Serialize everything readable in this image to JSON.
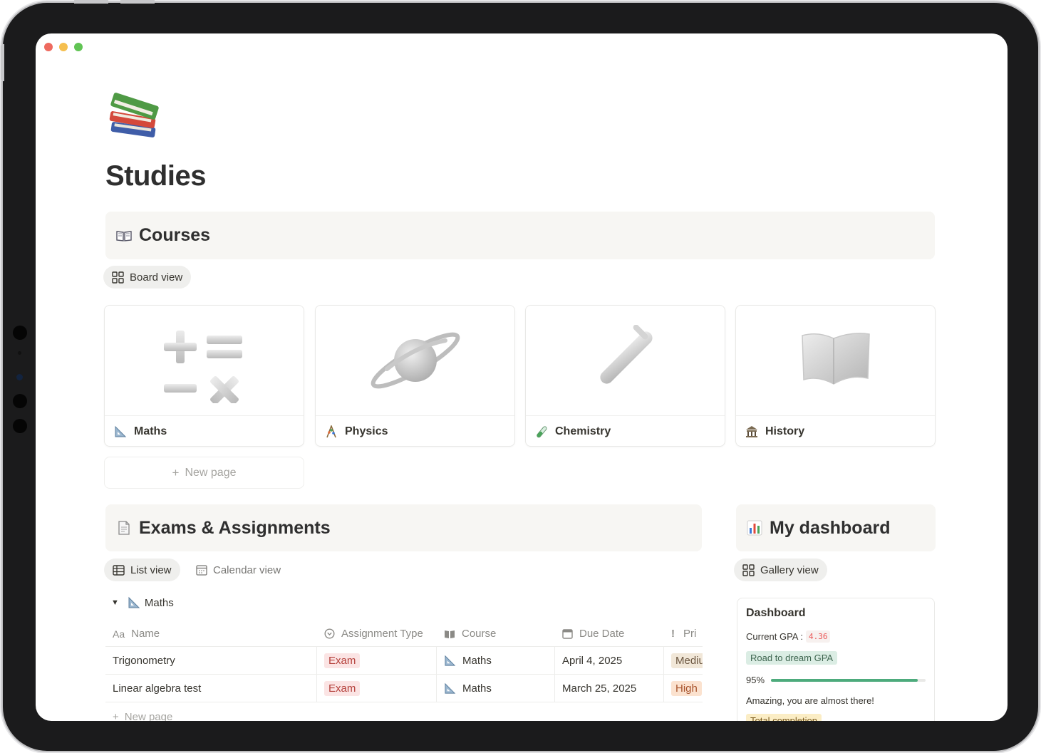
{
  "colors": {
    "close": "#ee6a5f",
    "minimize": "#f5bf4f",
    "zoom": "#61c454",
    "progress_fill": "#4dab7c"
  },
  "page": {
    "icon": "books-emoji",
    "title": "Studies"
  },
  "courses": {
    "icon": "open-book-icon",
    "title": "Courses",
    "view_label": "Board view",
    "cards": [
      {
        "title": "Maths",
        "icon": "triangle-ruler-icon",
        "cover": "math-symbols"
      },
      {
        "title": "Physics",
        "icon": "abacus-icon",
        "cover": "planet"
      },
      {
        "title": "Chemistry",
        "icon": "test-tube-icon",
        "cover": "test-tube"
      },
      {
        "title": "History",
        "icon": "classical-building-icon",
        "cover": "map"
      }
    ],
    "new_page": "New page"
  },
  "exams": {
    "icon": "document-icon",
    "title": "Exams & Assignments",
    "views": {
      "list": "List view",
      "calendar": "Calendar view"
    },
    "group": {
      "label": "Maths",
      "icon": "triangle-ruler-icon"
    },
    "columns": [
      "Name",
      "Assignment Type",
      "Course",
      "Due Date",
      "Pri"
    ],
    "rows": [
      {
        "name": "Trigonometry",
        "type": "Exam",
        "course": "Maths",
        "due": "April 4, 2025",
        "priority": "Mediu"
      },
      {
        "name": "Linear algebra test",
        "type": "Exam",
        "course": "Maths",
        "due": "March 25, 2025",
        "priority": "High"
      }
    ],
    "new_page": "New page"
  },
  "dashboard": {
    "icon": "bar-chart-icon",
    "title": "My dashboard",
    "view_label": "Gallery view",
    "card": {
      "title": "Dashboard",
      "gpa_label": "Current GPA :",
      "gpa_value": "4.36",
      "road_tag": "Road to dream GPA",
      "progress_label": "95%",
      "progress_value": 0.95,
      "message": "Amazing, you are almost there!",
      "completion_tag": "Total completion"
    }
  }
}
